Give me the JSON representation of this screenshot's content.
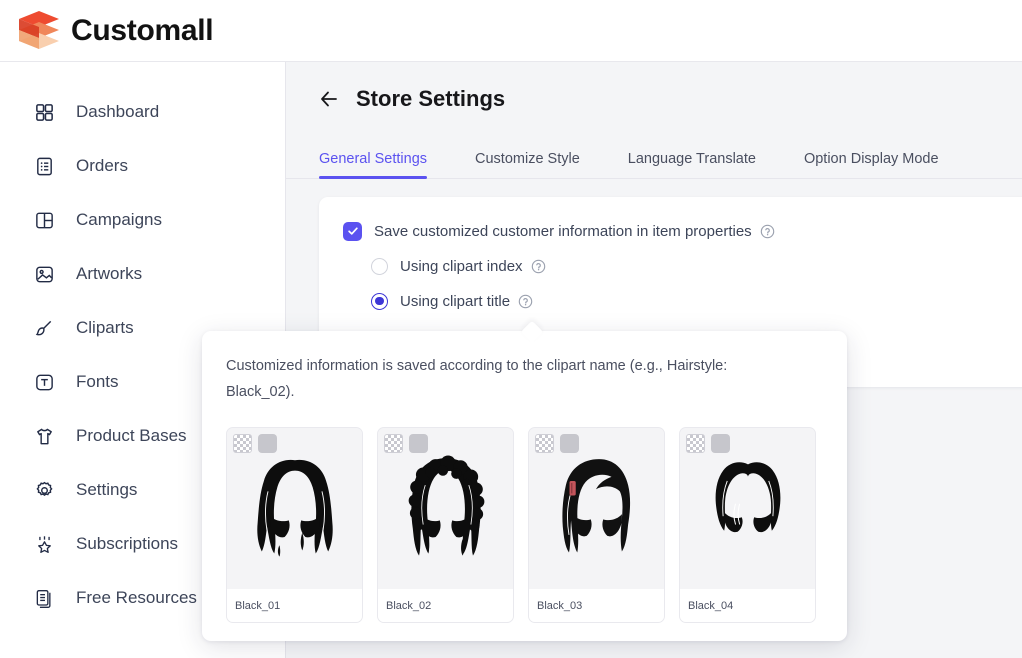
{
  "brand": {
    "name": "Customall",
    "logo_icon": "cube-stack-logo"
  },
  "sidebar": {
    "items": [
      {
        "label": "Dashboard",
        "icon": "grid-icon"
      },
      {
        "label": "Orders",
        "icon": "list-document-icon"
      },
      {
        "label": "Campaigns",
        "icon": "split-square-icon"
      },
      {
        "label": "Artworks",
        "icon": "image-icon"
      },
      {
        "label": "Cliparts",
        "icon": "brush-icon"
      },
      {
        "label": "Fonts",
        "icon": "font-t-icon"
      },
      {
        "label": "Product Bases",
        "icon": "tshirt-icon"
      },
      {
        "label": "Settings",
        "icon": "gear-icon"
      },
      {
        "label": "Subscriptions",
        "icon": "crown-star-icon"
      },
      {
        "label": "Free Resources",
        "icon": "documents-stack-icon"
      }
    ]
  },
  "header": {
    "back_icon": "arrow-left-icon",
    "title": "Store Settings"
  },
  "tabs": [
    {
      "label": "General Settings",
      "active": true
    },
    {
      "label": "Customize Style",
      "active": false
    },
    {
      "label": "Language Translate",
      "active": false
    },
    {
      "label": "Option Display Mode",
      "active": false
    }
  ],
  "settings": {
    "checkbox_label": "Save customized customer information in item properties",
    "checkbox_checked": true,
    "help_icon": "question-circle-icon",
    "radios": [
      {
        "label": "Using clipart index",
        "selected": false
      },
      {
        "label": "Using clipart title",
        "selected": true
      }
    ]
  },
  "tooltip": {
    "text": "Customized information is saved according to the clipart name (e.g., Hairstyle: Black_02).",
    "cliparts": [
      {
        "name": "Black_01",
        "style": "wavy-long-hair"
      },
      {
        "name": "Black_02",
        "style": "curly-afro-hair"
      },
      {
        "name": "Black_03",
        "style": "straight-side-part-hair"
      },
      {
        "name": "Black_04",
        "style": "short-wavy-bob-hair"
      }
    ],
    "badges": {
      "transparency": "checker-swatch-icon",
      "solid": "solid-swatch-icon"
    }
  },
  "colors": {
    "accent": "#5b52f0",
    "panel_bg": "#f4f5f7",
    "card_bg": "#ffffff",
    "text": "#3d4559"
  }
}
